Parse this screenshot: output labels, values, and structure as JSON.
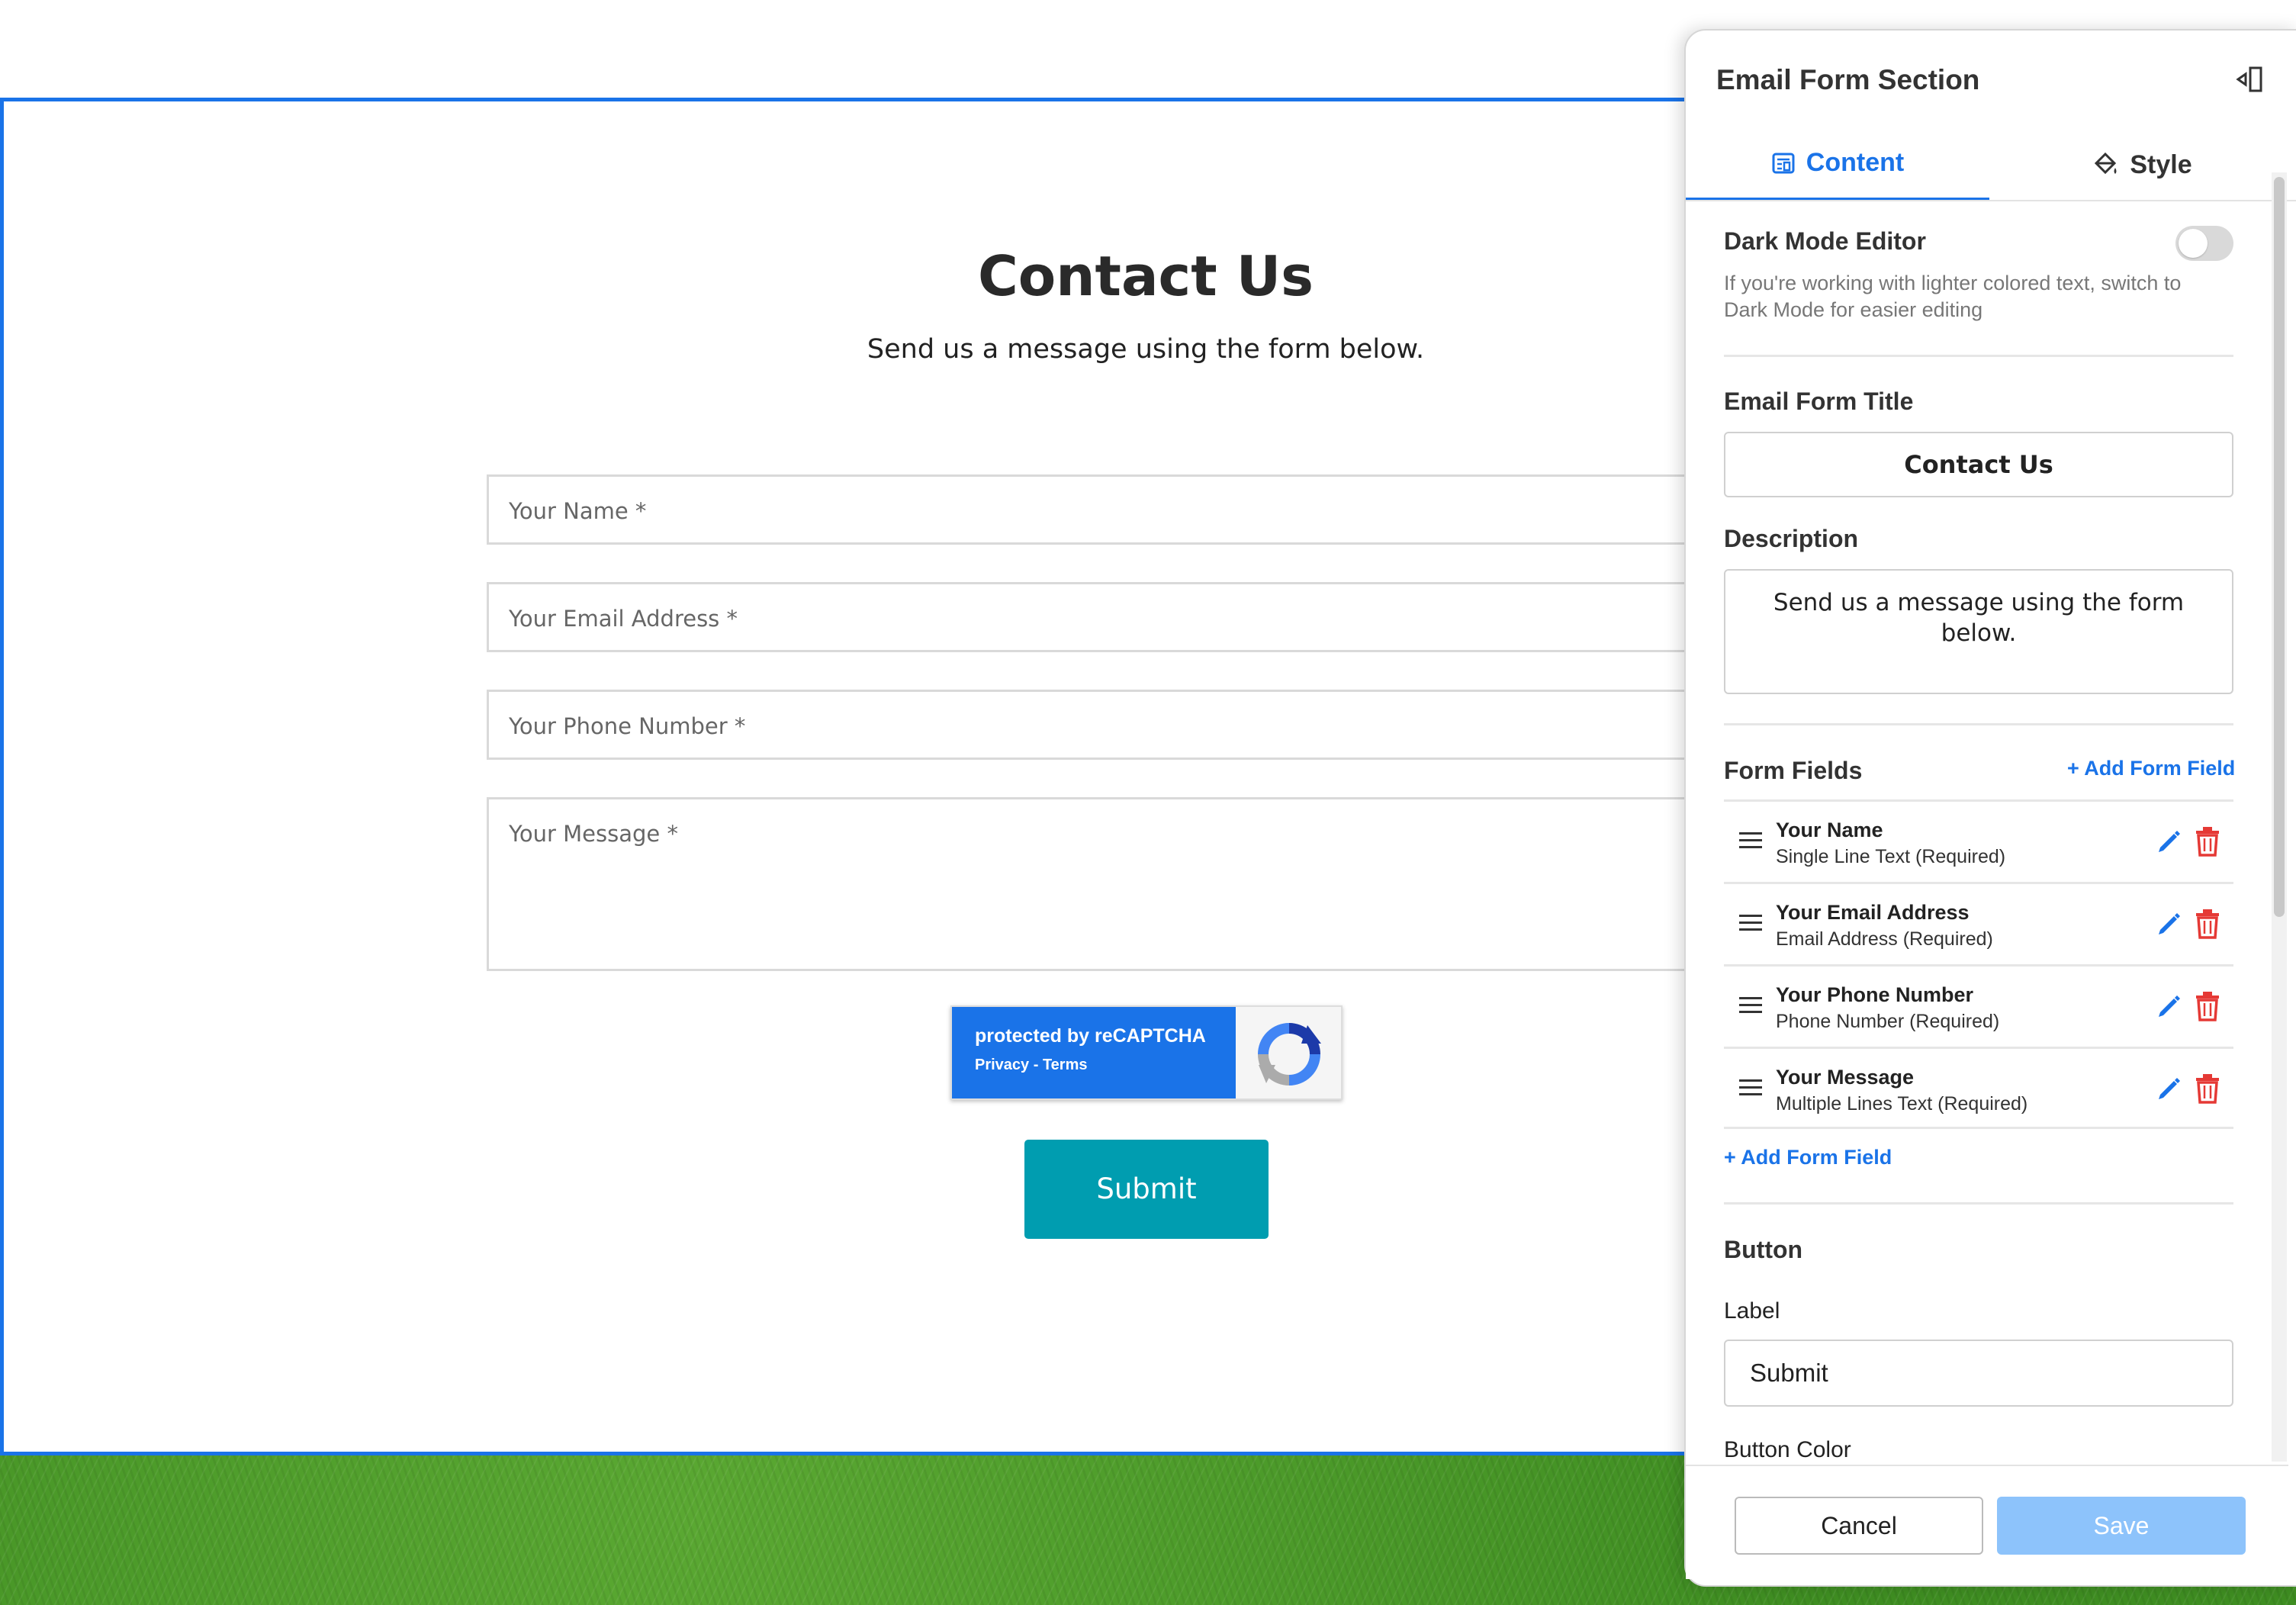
{
  "page": {
    "title": "Contact Us",
    "description": "Send us a message using the form below.",
    "fields": [
      "Your Name *",
      "Your Email Address *",
      "Your Phone Number *",
      "Your Message *"
    ],
    "recaptcha": {
      "line1": "protected by reCAPTCHA",
      "line2": "Privacy - Terms"
    },
    "submit_label": "Submit"
  },
  "panel": {
    "title": "Email Form Section",
    "tabs": {
      "content": "Content",
      "style": "Style"
    },
    "dark_mode": {
      "label": "Dark Mode Editor",
      "hint": "If you're working with lighter colored text, switch to Dark Mode for easier editing",
      "enabled": false
    },
    "title_label": "Email Form Title",
    "title_value": "Contact Us",
    "description_label": "Description",
    "description_value": "Send us a message using the form below.",
    "form_fields_label": "Form Fields",
    "add_field": "+ Add Form Field",
    "fields": [
      {
        "name": "Your Name",
        "type": "Single Line Text (Required)"
      },
      {
        "name": "Your Email Address",
        "type": "Email Address (Required)"
      },
      {
        "name": "Your Phone Number",
        "type": "Phone Number (Required)"
      },
      {
        "name": "Your Message",
        "type": "Multiple Lines Text (Required)"
      }
    ],
    "button_section": "Button",
    "label_label": "Label",
    "label_value": "Submit",
    "button_color_label": "Button Color",
    "cancel": "Cancel",
    "save": "Save"
  },
  "colors": {
    "accent": "#1a73e8",
    "submit": "#009db0",
    "delete": "#e53935",
    "save_disabled": "#8dc3fb"
  }
}
